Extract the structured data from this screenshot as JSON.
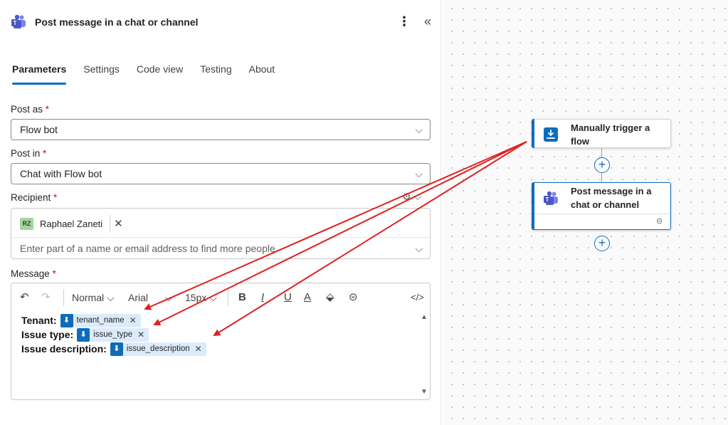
{
  "panel": {
    "title": "Post message in a chat or channel",
    "more_glyph": "⋮",
    "collapse_glyph": "«",
    "tabs": [
      {
        "label": "Parameters",
        "active": true
      },
      {
        "label": "Settings"
      },
      {
        "label": "Code view"
      },
      {
        "label": "Testing"
      },
      {
        "label": "About"
      }
    ]
  },
  "fields": {
    "post_as": {
      "label": "Post as",
      "value": "Flow bot"
    },
    "post_in": {
      "label": "Post in",
      "value": "Chat with Flow bot"
    },
    "recipient": {
      "label": "Recipient",
      "chip_initials": "RZ",
      "chip_name": "Raphael Zaneti",
      "placeholder": "Enter part of a name or email address to find more people"
    },
    "message": {
      "label": "Message",
      "toolbar": {
        "format": "Normal",
        "font": "Arial",
        "size": "15px"
      },
      "lines": [
        {
          "label": "Tenant:",
          "token": "tenant_name"
        },
        {
          "label": "Issue type:",
          "token": "issue_type"
        },
        {
          "label": "Issue description:",
          "token": "issue_description"
        }
      ]
    },
    "required_mark": "*"
  },
  "canvas": {
    "trigger_node": {
      "title": "Manually trigger a flow"
    },
    "action_node": {
      "title": "Post message in a chat or channel"
    }
  },
  "colors": {
    "accent": "#0f6cbd",
    "annotation_arrow": "#e02020",
    "required": "#c50f1f"
  }
}
